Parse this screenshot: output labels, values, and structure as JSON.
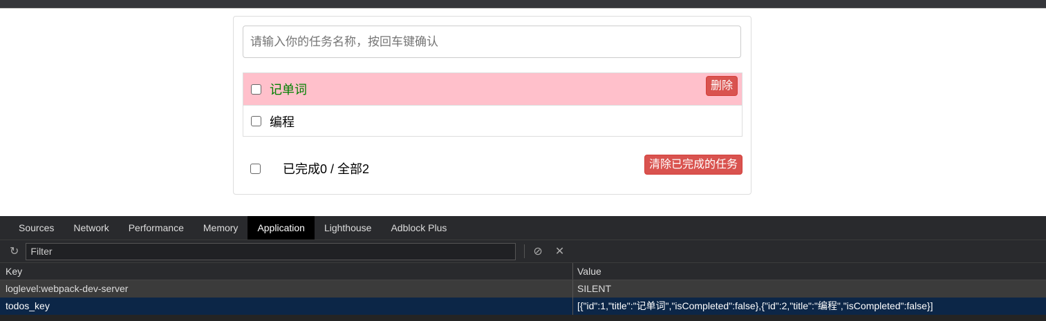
{
  "todo": {
    "input_placeholder": "请输入你的任务名称，按回车键确认",
    "items": [
      {
        "title": "记单词",
        "delete_label": "删除"
      },
      {
        "title": "编程"
      }
    ],
    "footer": {
      "status": "已完成0 / 全部2",
      "clear_label": "清除已完成的任务"
    }
  },
  "devtools": {
    "tabs": [
      "Sources",
      "Network",
      "Performance",
      "Memory",
      "Application",
      "Lighthouse",
      "Adblock Plus"
    ],
    "active_tab": "Application",
    "filter_placeholder": "Filter",
    "columns": {
      "key": "Key",
      "value": "Value"
    },
    "rows": [
      {
        "key": "loglevel:webpack-dev-server",
        "value": "SILENT"
      },
      {
        "key": "todos_key",
        "value": "[{\"id\":1,\"title\":\"记单词\",\"isCompleted\":false},{\"id\":2,\"title\":\"编程\",\"isCompleted\":false}]"
      }
    ]
  }
}
